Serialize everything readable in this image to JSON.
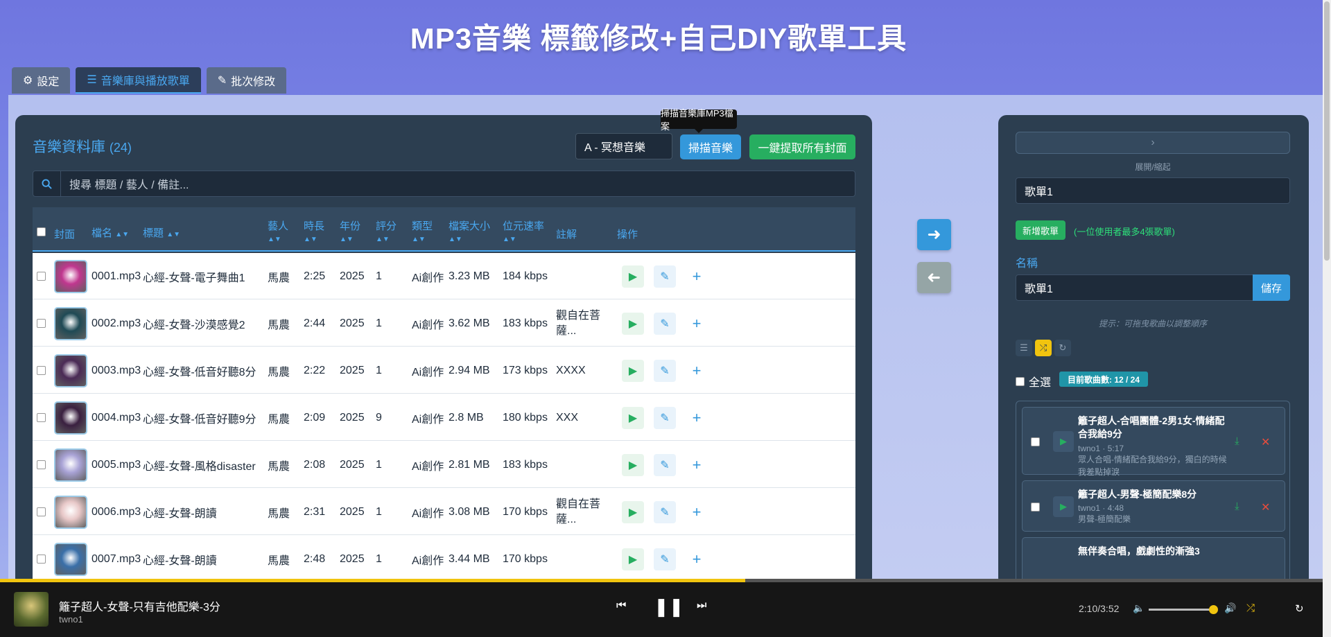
{
  "app": {
    "title": "MP3音樂 標籤修改+自己DIY歌單工具"
  },
  "tabs": [
    {
      "label": "設定",
      "icon": "gear-icon"
    },
    {
      "label": "音樂庫與播放歌單",
      "icon": "list-icon",
      "active": true
    },
    {
      "label": "批次修改",
      "icon": "edit-icon"
    }
  ],
  "library": {
    "title": "音樂資料庫",
    "count": "(24)",
    "folder_value": "A - 冥想音樂",
    "scan_label": "掃描音樂",
    "extract_covers_label": "一鍵提取所有封面",
    "scan_tooltip": "掃描音樂庫MP3檔案",
    "search_placeholder": "搜尋 標題 / 藝人 / 備註...",
    "columns": {
      "cover": "封面",
      "filename": "檔名",
      "title": "標題",
      "artist": "藝人",
      "duration": "時長",
      "year": "年份",
      "rating": "評分",
      "genre": "類型",
      "size": "檔案大小",
      "bitrate": "位元速率",
      "notes": "註解",
      "actions": "操作"
    },
    "rows": [
      {
        "file": "0001.mp3",
        "title": "心經-女聲-電子舞曲1",
        "artist": "馬農",
        "duration": "2:25",
        "year": "2025",
        "rating": "1",
        "genre": "Ai創作",
        "size": "3.23 MB",
        "bitrate": "184 kbps",
        "notes": ""
      },
      {
        "file": "0002.mp3",
        "title": "心經-女聲-沙漠感覺2",
        "artist": "馬農",
        "duration": "2:44",
        "year": "2025",
        "rating": "1",
        "genre": "Ai創作",
        "size": "3.62 MB",
        "bitrate": "183 kbps",
        "notes": "觀自在菩薩..."
      },
      {
        "file": "0003.mp3",
        "title": "心經-女聲-低音好聽8分",
        "artist": "馬農",
        "duration": "2:22",
        "year": "2025",
        "rating": "1",
        "genre": "Ai創作",
        "size": "2.94 MB",
        "bitrate": "173 kbps",
        "notes": "XXXX"
      },
      {
        "file": "0004.mp3",
        "title": "心經-女聲-低音好聽9分",
        "artist": "馬農",
        "duration": "2:09",
        "year": "2025",
        "rating": "9",
        "genre": "Ai創作",
        "size": "2.8 MB",
        "bitrate": "180 kbps",
        "notes": "XXX"
      },
      {
        "file": "0005.mp3",
        "title": "心經-女聲-風格disaster",
        "artist": "馬農",
        "duration": "2:08",
        "year": "2025",
        "rating": "1",
        "genre": "Ai創作",
        "size": "2.81 MB",
        "bitrate": "183 kbps",
        "notes": ""
      },
      {
        "file": "0006.mp3",
        "title": "心經-女聲-朗讀",
        "artist": "馬農",
        "duration": "2:31",
        "year": "2025",
        "rating": "1",
        "genre": "Ai創作",
        "size": "3.08 MB",
        "bitrate": "170 kbps",
        "notes": "觀自在菩薩..."
      },
      {
        "file": "0007.mp3",
        "title": "心經-女聲-朗讀",
        "artist": "馬農",
        "duration": "2:48",
        "year": "2025",
        "rating": "1",
        "genre": "Ai創作",
        "size": "3.44 MB",
        "bitrate": "170 kbps",
        "notes": ""
      }
    ],
    "cover_colors": [
      "#c0378f",
      "#1f4a55",
      "#4a2a55",
      "#3a2040",
      "#a9a3d6",
      "#e8c8c8",
      "#3a6fa8"
    ]
  },
  "playlist": {
    "collapse_label": "展開/縮起",
    "selected_playlist": "歌單1",
    "new_label": "新增歌單",
    "limit_text": "(一位使用者最多4張歌單)",
    "name_label": "名稱",
    "name_value": "歌單1",
    "save_label": "儲存",
    "hint": "提示：可拖曳歌曲以調整順序",
    "select_all": "全選",
    "count": "目前歌曲數: 12 / 24",
    "songs": [
      {
        "title": "籬子超人-合唱團體-2男1女-情緒配合我給9分",
        "meta": "twno1 · 5:17",
        "desc": "眾人合唱-情緒配合我給9分，獨白的時候我差點掉淚"
      },
      {
        "title": "籬子超人-男聲-極簡配樂8分",
        "meta": "twno1 · 4:48",
        "desc": "男聲-極簡配樂"
      },
      {
        "title": "無伴奏合唱，戲劇性的漸強3",
        "meta": "",
        "desc": ""
      }
    ]
  },
  "player": {
    "song": "籬子超人-女聲-只有吉他配樂-3分",
    "artist": "twno1",
    "time": "2:10/3:52",
    "progress": 0.56,
    "volume": 1.0
  },
  "colors": {
    "accent": "#4aa8f0",
    "green": "#27ae60",
    "yellow": "#f1c40f",
    "panel": "#2c3e50"
  }
}
